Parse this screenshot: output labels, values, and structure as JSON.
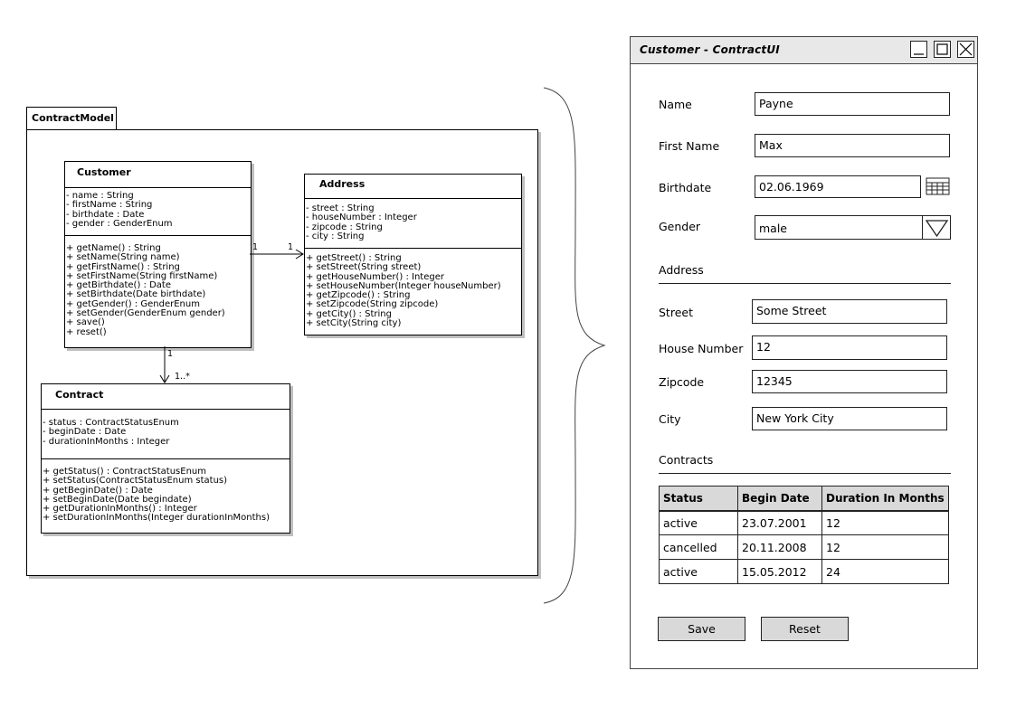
{
  "uml": {
    "package": "ContractModel",
    "customer": {
      "name": "Customer",
      "attributes": [
        "- name : String",
        "- firstName : String",
        "- birthdate : Date",
        "- gender : GenderEnum"
      ],
      "operations": [
        "+ getName() : String",
        "+ setName(String name)",
        "+ getFirstName() : String",
        "+ setFirstName(String firstName)",
        "+ getBirthdate() : Date",
        "+ setBirthdate(Date birthdate)",
        "+ getGender() : GenderEnum",
        "+ setGender(GenderEnum gender)",
        "+ save()",
        "+ reset()"
      ]
    },
    "address": {
      "name": "Address",
      "attributes": [
        "- street : String",
        "- houseNumber : Integer",
        "- zipcode : String",
        "- city : String"
      ],
      "operations": [
        "+ getStreet() : String",
        "+ setStreet(String street)",
        "+ getHouseNumber() : Integer",
        "+ setHouseNumber(Integer houseNumber)",
        "+ getZipcode() : String",
        "+ setZipcode(String zipcode)",
        "+ getCity() : String",
        "+ setCity(String city)"
      ]
    },
    "contract": {
      "name": "Contract",
      "attributes": [
        "- status : ContractStatusEnum",
        "- beginDate : Date",
        "- durationInMonths : Integer"
      ],
      "operations": [
        "+ getStatus() : ContractStatusEnum",
        "+ setStatus(ContractStatusEnum status)",
        "+ getBeginDate() : Date",
        "+ setBeginDate(Date begindate)",
        "+ getDurationInMonths() : Integer",
        "+ setDurationInMonths(Integer durationInMonths)"
      ]
    },
    "assoc_customer_address": {
      "source_mult": "1",
      "target_mult": "1"
    },
    "assoc_customer_contract": {
      "source_mult": "1",
      "target_mult": "1..*"
    }
  },
  "window": {
    "title": "Customer - ContractUI",
    "controls": [
      "minimize-icon",
      "maximize-icon",
      "close-icon"
    ],
    "name_label": "Name",
    "name_value": "Payne",
    "firstname_label": "First Name",
    "firstname_value": "Max",
    "birthdate_label": "Birthdate",
    "birthdate_value": "02.06.1969",
    "gender_label": "Gender",
    "gender_value": "male",
    "address_section": "Address",
    "street_label": "Street",
    "street_value": "Some Street",
    "housenumber_label": "House Number",
    "housenumber_value": "12",
    "zipcode_label": "Zipcode",
    "zipcode_value": "12345",
    "city_label": "City",
    "city_value": "New York City",
    "contracts_section": "Contracts",
    "table": {
      "headers": [
        "Status",
        "Begin Date",
        "Duration In Months"
      ],
      "rows": [
        [
          "active",
          "23.07.2001",
          "12"
        ],
        [
          "cancelled",
          "20.11.2008",
          "12"
        ],
        [
          "active",
          "15.05.2012",
          "24"
        ]
      ]
    },
    "save_label": "Save",
    "reset_label": "Reset"
  }
}
